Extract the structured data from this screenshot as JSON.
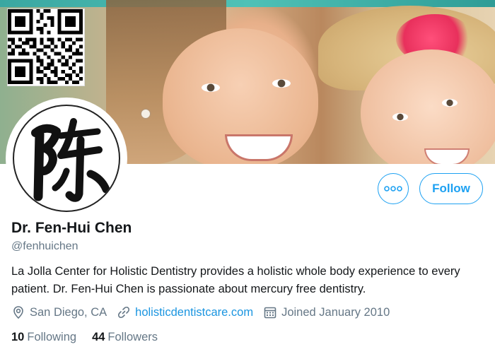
{
  "profile": {
    "name": "Dr. Fen-Hui Chen",
    "handle": "@fenhuichen",
    "bio": "La Jolla Center for Holistic Dentistry provides a holistic whole body experience to every patient.  Dr. Fen-Hui Chen is passionate about mercury free dentistry.",
    "location": "San Diego, CA",
    "website": "holisticdentistcare.com",
    "joined": "Joined January 2010"
  },
  "stats": {
    "following_count": "10",
    "following_label": "Following",
    "followers_count": "44",
    "followers_label": "Followers"
  },
  "actions": {
    "follow_label": "Follow",
    "more_label": "ooo"
  },
  "icons": {
    "location": "location-pin-icon",
    "link": "link-icon",
    "calendar": "calendar-icon",
    "more": "more-options-icon"
  },
  "colors": {
    "accent": "#1da1f2",
    "link": "#1b95e0",
    "muted": "#657786",
    "text": "#14171a"
  }
}
